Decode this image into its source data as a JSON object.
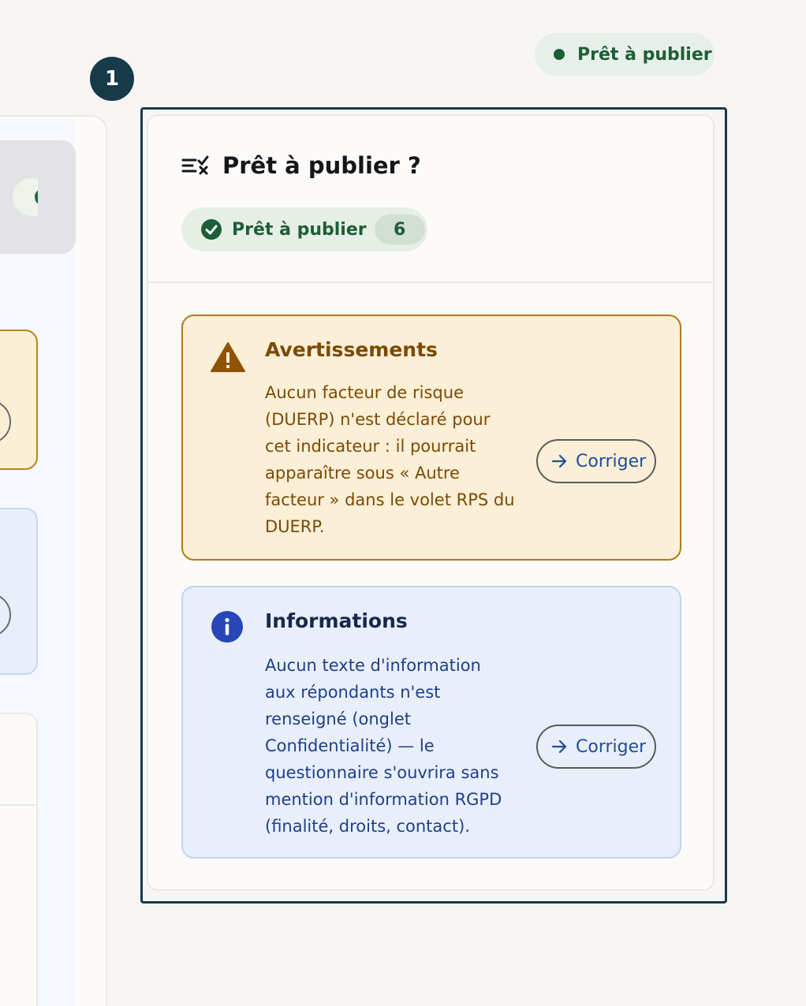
{
  "colors": {
    "step_badge": "#163a4a",
    "success_green": "#1d5e36",
    "warning_text": "#7c4a02",
    "warning_bg": "#fcefd7",
    "info_text": "#1f3f8a",
    "info_bg": "#e8effa",
    "link_blue": "#1f4f96"
  },
  "step_badge": {
    "number": "1"
  },
  "status_pill": {
    "label": "Prêt à publier",
    "icon": "dot-icon"
  },
  "panel": {
    "title": "Prêt à publier ?",
    "title_icon": "checklist-icon",
    "ready_chip": {
      "label": "Prêt à publier",
      "count": "6",
      "icon": "check-circle-icon"
    }
  },
  "alerts": {
    "warning": {
      "icon": "warning-triangle-icon",
      "title": "Avertissements",
      "lines": [
        "Aucun facteur de risque",
        "(DUERP) n'est déclaré pour",
        "cet indicateur : il pourrait",
        "apparaître sous « Autre",
        "facteur » dans le volet RPS du",
        "DUERP."
      ],
      "action_label": "Corriger",
      "action_icon": "arrow-right-icon"
    },
    "info": {
      "icon": "info-circle-icon",
      "title": "Informations",
      "lines": [
        "Aucun texte d'information",
        "aux répondants n'est",
        "renseigné (onglet",
        "Confidentialité) — le",
        "questionnaire s'ouvrira sans",
        "mention d'information RGPD",
        "(finalité, droits, contact)."
      ],
      "action_label": "Corriger",
      "action_icon": "arrow-right-icon"
    }
  }
}
